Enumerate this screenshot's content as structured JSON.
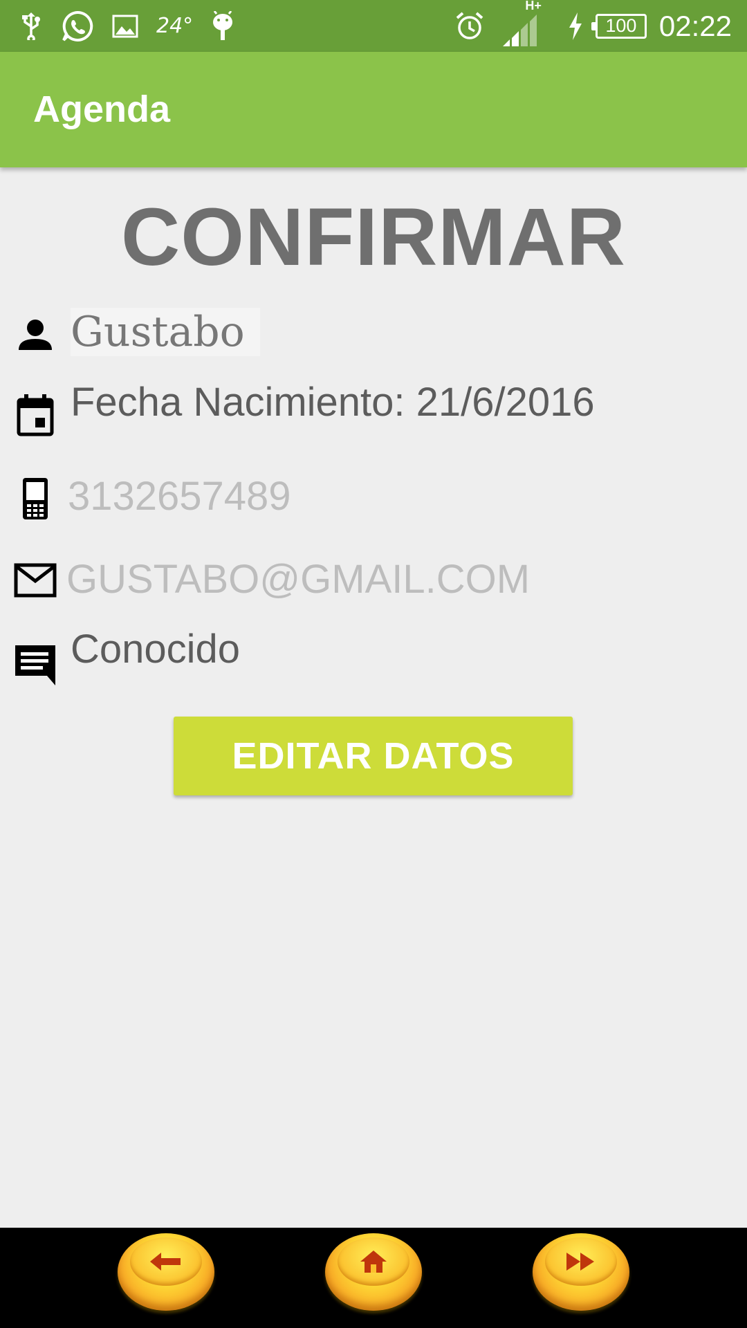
{
  "status_bar": {
    "temperature": "24°",
    "network": "H+",
    "battery": "100",
    "time": "02:22"
  },
  "toolbar": {
    "title": "Agenda"
  },
  "main": {
    "heading": "CONFIRMAR",
    "name": "Gustabo",
    "birth_date": "Fecha Nacimiento: 21/6/2016",
    "phone": "3132657489",
    "email": "GUSTABO@GMAIL.COM",
    "note": "Conocido",
    "edit_button": "EDITAR DATOS"
  },
  "colors": {
    "status_bar": "#689f38",
    "toolbar": "#8bc34a",
    "button": "#cddc39",
    "background": "#eeeeee"
  },
  "bottom_nav": {
    "items": [
      {
        "icon": "arrow-left-icon"
      },
      {
        "icon": "home-icon"
      },
      {
        "icon": "fast-forward-icon"
      }
    ]
  }
}
